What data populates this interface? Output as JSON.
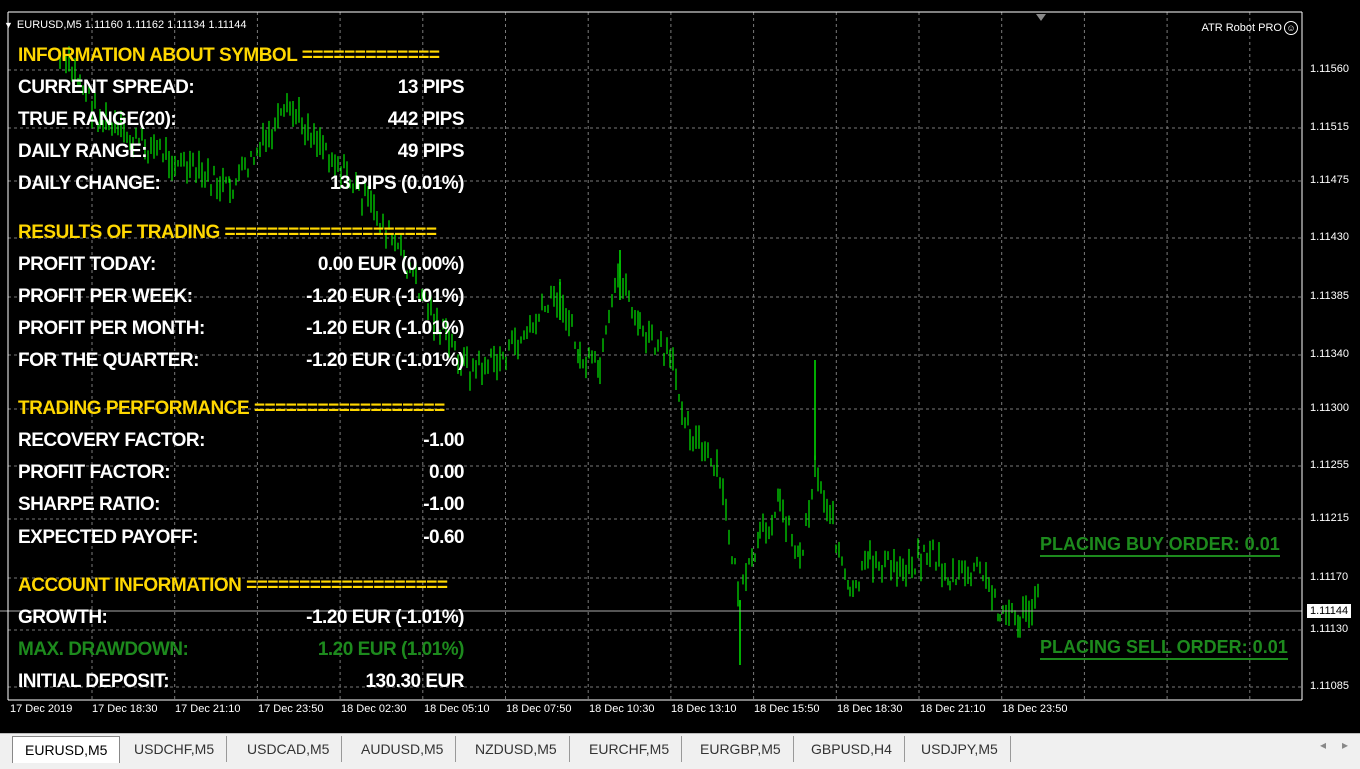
{
  "chart": {
    "symbol_header": "EURUSD,M5  1.11160 1.11162 1.11134 1.11144",
    "ea_name": "ATR Robot PRO",
    "current_price": "1.11144",
    "price_axis": [
      "1.11560",
      "1.11515",
      "1.11475",
      "1.11430",
      "1.11385",
      "1.11340",
      "1.11300",
      "1.11255",
      "1.11215",
      "1.11170",
      "1.11130",
      "1.11085"
    ],
    "time_axis": [
      "17 Dec 2019",
      "17 Dec 18:30",
      "17 Dec 21:10",
      "17 Dec 23:50",
      "18 Dec 02:30",
      "18 Dec 05:10",
      "18 Dec 07:50",
      "18 Dec 10:30",
      "18 Dec 13:10",
      "18 Dec 15:50",
      "18 Dec 18:30",
      "18 Dec 21:10",
      "18 Dec 23:50"
    ],
    "colors": {
      "background": "#000000",
      "grid": "#7a7a7a",
      "candles": "#00e600",
      "section": "#ffd700",
      "dim": "#1d8a1d"
    }
  },
  "info_panel": {
    "symbol_title": "INFORMATION ABOUT SYMBOL =============",
    "current_spread": {
      "label": "CURRENT SPREAD:",
      "value": "13 PIPS"
    },
    "true_range": {
      "label": "TRUE RANGE(20):",
      "value": "442 PIPS"
    },
    "daily_range": {
      "label": "DAILY RANGE:",
      "value": "49 PIPS"
    },
    "daily_change": {
      "label": "DAILY CHANGE:",
      "value": "13 PIPS (0.01%)"
    },
    "results_title": "RESULTS OF TRADING ====================",
    "profit_today": {
      "label": "PROFIT TODAY:",
      "value": "0.00 EUR (0.00%)"
    },
    "profit_week": {
      "label": "PROFIT PER WEEK:",
      "value": "-1.20 EUR (-1.01%)"
    },
    "profit_month": {
      "label": "PROFIT PER MONTH:",
      "value": "-1.20 EUR (-1.01%)"
    },
    "quarter": {
      "label": "FOR THE QUARTER:",
      "value": "-1.20 EUR (-1.01%)"
    },
    "performance_title": "TRADING PERFORMANCE ==================",
    "recovery_factor": {
      "label": "RECOVERY FACTOR:",
      "value": "-1.00"
    },
    "profit_factor": {
      "label": "PROFIT FACTOR:",
      "value": "0.00"
    },
    "sharpe_ratio": {
      "label": "SHARPE RATIO:",
      "value": "-1.00"
    },
    "expected_payoff": {
      "label": "EXPECTED PAYOFF:",
      "value": "-0.60"
    },
    "account_title": "ACCOUNT INFORMATION ===================",
    "growth": {
      "label": "GROWTH:",
      "value": "-1.20 EUR (-1.01%)"
    },
    "max_drawdown": {
      "label": "MAX. DRAWDOWN:",
      "value": "1.20 EUR (1.01%)"
    },
    "initial_deposit": {
      "label": "INITIAL DEPOSIT:",
      "value": "130.30 EUR"
    }
  },
  "orders": {
    "buy": "PLACING BUY ORDER:  0.01",
    "sell": "PLACING SELL ORDER:  0.01"
  },
  "tabs": [
    "EURUSD,M5",
    "USDCHF,M5",
    "USDCAD,M5",
    "AUDUSD,M5",
    "NZDUSD,M5",
    "EURCHF,M5",
    "EURGBP,M5",
    "GBPUSD,H4",
    "USDJPY,M5"
  ],
  "tab_scroll": {
    "left": "◂",
    "right": "▸"
  }
}
